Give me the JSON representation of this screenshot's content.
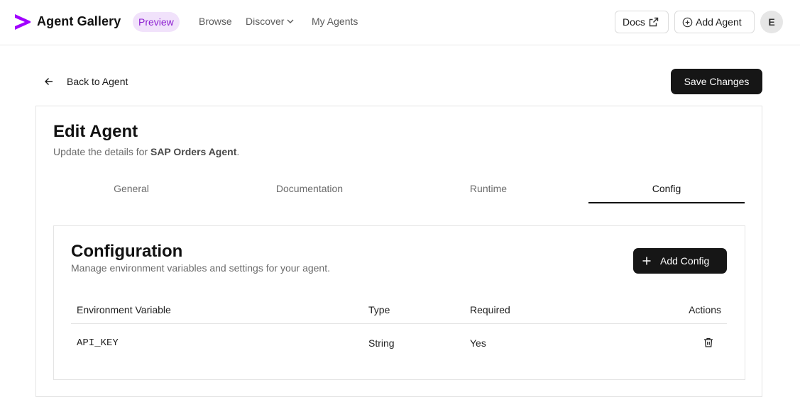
{
  "header": {
    "app_title": "Agent Gallery",
    "badge": "Preview",
    "nav": [
      {
        "label": "Browse"
      },
      {
        "label": "Discover"
      },
      {
        "label": "My Agents"
      }
    ],
    "docs_label": "Docs",
    "add_agent_label": "Add Agent",
    "avatar_initial": "E",
    "brand_color": "#a100ff"
  },
  "subbar": {
    "back_label": "Back to Agent",
    "save_label": "Save Changes"
  },
  "edit": {
    "title": "Edit Agent",
    "subtitle_prefix": "Update the details for ",
    "agent_name": "SAP Orders Agent",
    "subtitle_suffix": ".",
    "tabs": [
      {
        "label": "General",
        "active": false
      },
      {
        "label": "Documentation",
        "active": false
      },
      {
        "label": "Runtime",
        "active": false
      },
      {
        "label": "Config",
        "active": true
      }
    ]
  },
  "config": {
    "title": "Configuration",
    "subtitle": "Manage environment variables and settings for your agent.",
    "add_label": "Add Config",
    "columns": [
      "Environment Variable",
      "Type",
      "Required",
      "Actions"
    ],
    "rows": [
      {
        "variable": "API_KEY",
        "type": "String",
        "required": "Yes"
      }
    ]
  }
}
